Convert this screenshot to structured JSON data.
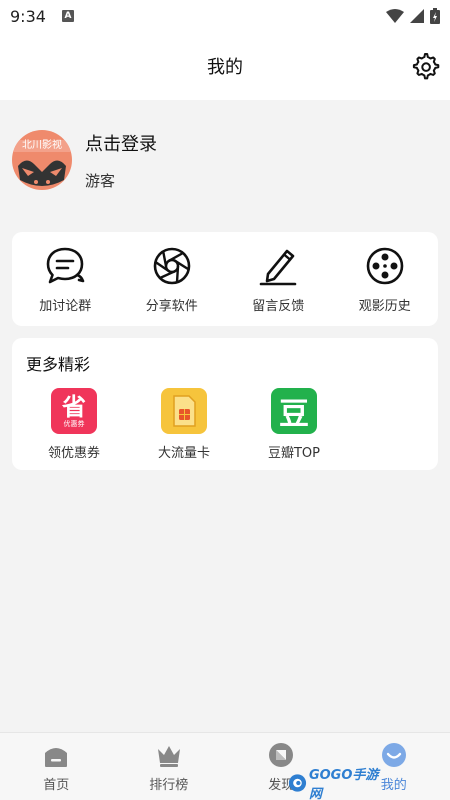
{
  "status": {
    "time": "9:34",
    "notif_letter": "A"
  },
  "header": {
    "title": "我的"
  },
  "profile": {
    "login_label": "点击登录",
    "guest_label": "游客",
    "avatar_caption": "北川影视"
  },
  "tools": [
    {
      "label": "加讨论群",
      "icon": "chat-bubble-icon"
    },
    {
      "label": "分享软件",
      "icon": "aperture-icon"
    },
    {
      "label": "留言反馈",
      "icon": "pencil-icon"
    },
    {
      "label": "观影历史",
      "icon": "film-reel-icon"
    }
  ],
  "more": {
    "title": "更多精彩",
    "items": [
      {
        "label": "领优惠券",
        "icon_text": "省",
        "icon_sub": "优惠券",
        "color": "#f0355a"
      },
      {
        "label": "大流量卡",
        "icon": "sim-card-icon",
        "color": "#f6c43c"
      },
      {
        "label": "豆瓣TOP",
        "icon_text": "豆",
        "color": "#22b14c"
      }
    ]
  },
  "nav": [
    {
      "label": "首页",
      "icon": "home-icon"
    },
    {
      "label": "排行榜",
      "icon": "crown-icon"
    },
    {
      "label": "发现",
      "icon": "compass-icon"
    },
    {
      "label": "我的",
      "icon": "smile-icon",
      "active": true
    }
  ],
  "watermark": {
    "text": "GOGO手游网"
  },
  "colors": {
    "accent": "#4a86d8",
    "avatar": "#ef8a6c"
  }
}
